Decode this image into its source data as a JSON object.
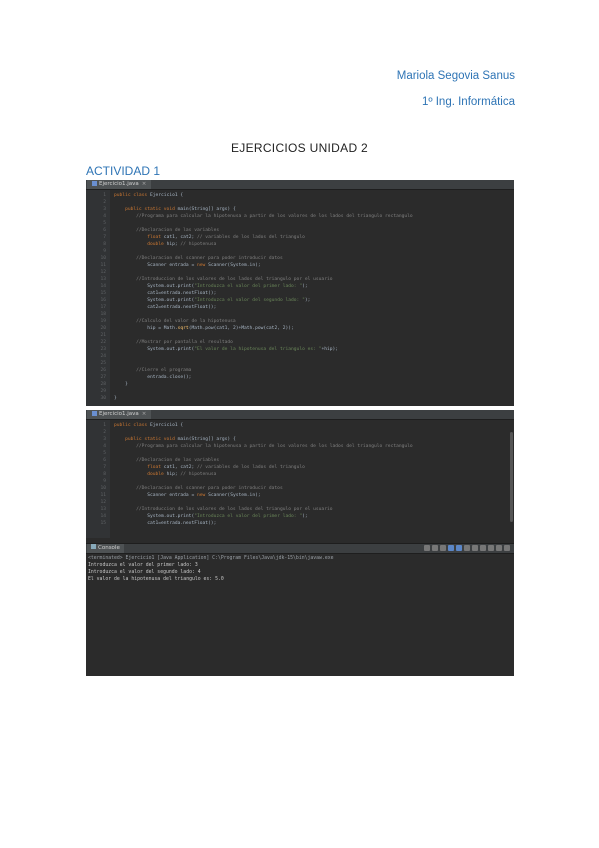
{
  "header": {
    "author": "Mariola Segovia Sanus",
    "degree": "1º Ing. Informática"
  },
  "document": {
    "title": "EJERCICIOS UNIDAD 2",
    "section": "ACTIVIDAD 1"
  },
  "editor1": {
    "tab_label": "Ejercicio1.java",
    "lines": [
      {
        "n": "1",
        "segments": [
          {
            "t": "public class ",
            "c": "kw"
          },
          {
            "t": "Ejercicio1 {",
            "c": ""
          }
        ]
      },
      {
        "n": "2",
        "segments": []
      },
      {
        "n": "3",
        "segments": [
          {
            "t": "    public static void ",
            "c": "kw"
          },
          {
            "t": "main(String[] args) {",
            "c": ""
          }
        ]
      },
      {
        "n": "4",
        "segments": [
          {
            "t": "        //Programa para calcular la hipotenusa a partir de los valores de los lados del triangulo rectangulo",
            "c": "cm"
          }
        ]
      },
      {
        "n": "5",
        "segments": []
      },
      {
        "n": "6",
        "segments": [
          {
            "t": "        //Declaracion de las variables",
            "c": "cm"
          }
        ]
      },
      {
        "n": "7",
        "segments": [
          {
            "t": "            float ",
            "c": "kw"
          },
          {
            "t": "cat1, cat2; ",
            "c": ""
          },
          {
            "t": "// variables de los lados del triangulo",
            "c": "cm"
          }
        ]
      },
      {
        "n": "8",
        "segments": [
          {
            "t": "            double ",
            "c": "kw"
          },
          {
            "t": "hip; ",
            "c": ""
          },
          {
            "t": "// hipotenusa",
            "c": "cm"
          }
        ]
      },
      {
        "n": "9",
        "segments": []
      },
      {
        "n": "10",
        "segments": [
          {
            "t": "        //Declaracion del scanner para poder introducir datos",
            "c": "cm"
          }
        ]
      },
      {
        "n": "11",
        "segments": [
          {
            "t": "            Scanner entrada = ",
            "c": ""
          },
          {
            "t": "new ",
            "c": "kw"
          },
          {
            "t": "Scanner(System.in);",
            "c": ""
          }
        ]
      },
      {
        "n": "12",
        "segments": []
      },
      {
        "n": "13",
        "segments": [
          {
            "t": "        //Introduccion de los valores de los lados del triangulo por el usuario",
            "c": "cm"
          }
        ]
      },
      {
        "n": "14",
        "segments": [
          {
            "t": "            System.out.print(",
            "c": ""
          },
          {
            "t": "\"Introduzca el valor del primer lado: \"",
            "c": "st"
          },
          {
            "t": ");",
            "c": ""
          }
        ]
      },
      {
        "n": "15",
        "segments": [
          {
            "t": "            cat1=entrada.nextFloat();",
            "c": ""
          }
        ]
      },
      {
        "n": "16",
        "segments": [
          {
            "t": "            System.out.print(",
            "c": ""
          },
          {
            "t": "\"Introduzca el valor del segundo lado: \"",
            "c": "st"
          },
          {
            "t": ");",
            "c": ""
          }
        ]
      },
      {
        "n": "17",
        "segments": [
          {
            "t": "            cat2=entrada.nextFloat();",
            "c": ""
          }
        ]
      },
      {
        "n": "18",
        "segments": []
      },
      {
        "n": "19",
        "segments": [
          {
            "t": "        //Calculo del valor de la hipotenusa",
            "c": "cm"
          }
        ]
      },
      {
        "n": "20",
        "segments": [
          {
            "t": "            hip = Math.",
            "c": ""
          },
          {
            "t": "sqrt",
            "c": "fn"
          },
          {
            "t": "(Math.pow(cat1, 2)+Math.pow(cat2, 2));",
            "c": ""
          }
        ]
      },
      {
        "n": "21",
        "segments": []
      },
      {
        "n": "22",
        "segments": [
          {
            "t": "        //Mostrar por pantalla el resultado",
            "c": "cm"
          }
        ]
      },
      {
        "n": "23",
        "segments": [
          {
            "t": "            System.out.print(",
            "c": ""
          },
          {
            "t": "\"El valor de la hipotenusa del triangulo es: \"",
            "c": "st"
          },
          {
            "t": "+hip);",
            "c": ""
          }
        ]
      },
      {
        "n": "24",
        "segments": []
      },
      {
        "n": "25",
        "segments": []
      },
      {
        "n": "26",
        "segments": [
          {
            "t": "        //Cierre el programa",
            "c": "cm"
          }
        ]
      },
      {
        "n": "27",
        "segments": [
          {
            "t": "            entrada.close();",
            "c": ""
          }
        ]
      },
      {
        "n": "28",
        "segments": [
          {
            "t": "    }",
            "c": ""
          }
        ]
      },
      {
        "n": "29",
        "segments": []
      },
      {
        "n": "30",
        "segments": [
          {
            "t": "}",
            "c": ""
          }
        ]
      }
    ]
  },
  "editor2": {
    "tab_label": "Ejercicio1.java",
    "lines": [
      {
        "n": "1",
        "segments": [
          {
            "t": "public class ",
            "c": "kw"
          },
          {
            "t": "Ejercicio1 {",
            "c": ""
          }
        ]
      },
      {
        "n": "2",
        "segments": []
      },
      {
        "n": "3",
        "segments": [
          {
            "t": "    public static void ",
            "c": "kw"
          },
          {
            "t": "main(String[] args) {",
            "c": ""
          }
        ]
      },
      {
        "n": "4",
        "segments": [
          {
            "t": "        //Programa para calcular la hipotenusa a partir de los valores de los lados del triangulo rectangulo",
            "c": "cm"
          }
        ]
      },
      {
        "n": "5",
        "segments": []
      },
      {
        "n": "6",
        "segments": [
          {
            "t": "        //Declaracion de las variables",
            "c": "cm"
          }
        ]
      },
      {
        "n": "7",
        "segments": [
          {
            "t": "            float ",
            "c": "kw"
          },
          {
            "t": "cat1, cat2; ",
            "c": ""
          },
          {
            "t": "// variables de los lados del triangulo",
            "c": "cm"
          }
        ]
      },
      {
        "n": "8",
        "segments": [
          {
            "t": "            double ",
            "c": "kw"
          },
          {
            "t": "hip; ",
            "c": ""
          },
          {
            "t": "// hipotenusa",
            "c": "cm"
          }
        ]
      },
      {
        "n": "9",
        "segments": []
      },
      {
        "n": "10",
        "segments": [
          {
            "t": "        //Declaracion del scanner para poder introducir datos",
            "c": "cm"
          }
        ]
      },
      {
        "n": "11",
        "segments": [
          {
            "t": "            Scanner entrada = ",
            "c": ""
          },
          {
            "t": "new ",
            "c": "kw"
          },
          {
            "t": "Scanner(System.in);",
            "c": ""
          }
        ]
      },
      {
        "n": "12",
        "segments": []
      },
      {
        "n": "13",
        "segments": [
          {
            "t": "        //Introduccion de los valores de los lados del triangulo por el usuario",
            "c": "cm"
          }
        ]
      },
      {
        "n": "14",
        "segments": [
          {
            "t": "            System.out.print(",
            "c": ""
          },
          {
            "t": "\"Introduzca el valor del primer lado: \"",
            "c": "st"
          },
          {
            "t": ");",
            "c": ""
          }
        ]
      },
      {
        "n": "15",
        "segments": [
          {
            "t": "            cat1=entrada.nextFloat();",
            "c": ""
          }
        ]
      }
    ]
  },
  "console": {
    "tab_label": "Console",
    "terminated": "<terminated> Ejercicio1 [Java Application] C:\\Program Files\\Java\\jdk-15\\bin\\javaw.exe",
    "lines": [
      "Introduzca el valor del primer lado: 3",
      "Introduzca el valor del segundo lado: 4",
      "El valor de la hipotenusa del triangulo es: 5.0"
    ]
  },
  "colors": {
    "accent": "#2e74b5",
    "editor_bg": "#2b2b2b",
    "keyword": "#cc7832",
    "comment": "#808080",
    "string": "#6a8759"
  }
}
